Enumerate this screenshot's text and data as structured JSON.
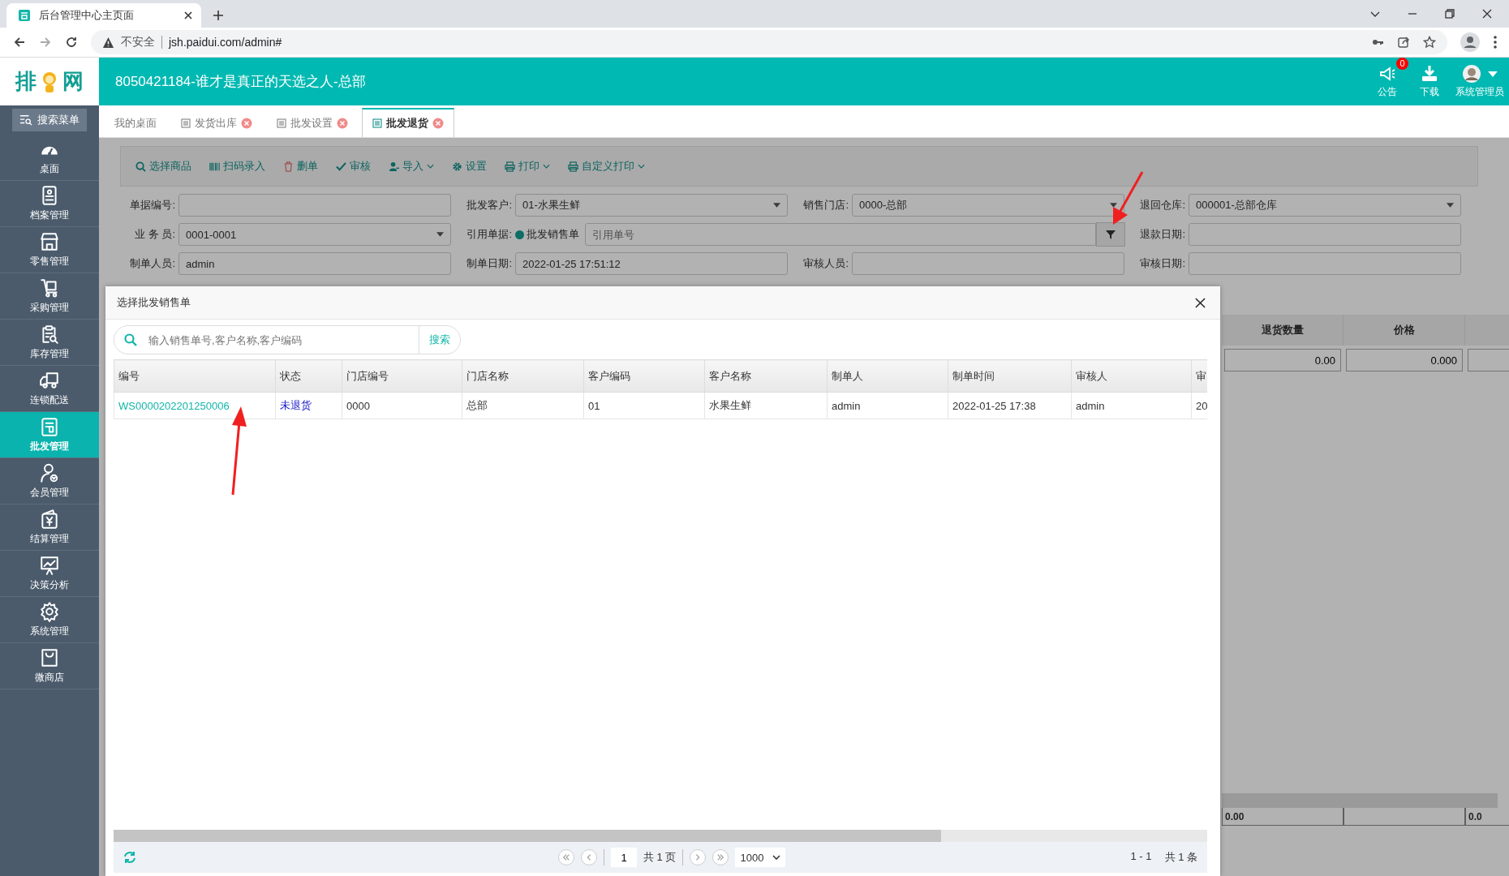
{
  "browser": {
    "tab_title": "后台管理中心主页面",
    "security": "不安全",
    "url": "jsh.paidui.com/admin#"
  },
  "header": {
    "logo": {
      "left": "排",
      "right": "网"
    },
    "title": "8050421184-谁才是真正的天选之人-总部",
    "actions": [
      {
        "kind": "notice",
        "label": "公告",
        "badge": "0"
      },
      {
        "kind": "download",
        "label": "下载"
      },
      {
        "kind": "user",
        "label": "系统管理员"
      }
    ]
  },
  "sidebar": {
    "search_button": "搜索菜单",
    "items": [
      {
        "kind": "dashboard",
        "label": "桌面",
        "selected": false
      },
      {
        "kind": "file",
        "label": "档案管理",
        "selected": false
      },
      {
        "kind": "shop",
        "label": "零售管理",
        "selected": false
      },
      {
        "kind": "cart",
        "label": "采购管理",
        "selected": false
      },
      {
        "kind": "clipboard",
        "label": "库存管理",
        "selected": false
      },
      {
        "kind": "truck",
        "label": "连锁配送",
        "selected": false
      },
      {
        "kind": "wholesale",
        "label": "批发管理",
        "selected": true
      },
      {
        "kind": "member",
        "label": "会员管理",
        "selected": false
      },
      {
        "kind": "wallet",
        "label": "结算管理",
        "selected": false
      },
      {
        "kind": "chart",
        "label": "决策分析",
        "selected": false
      },
      {
        "kind": "gear",
        "label": "系统管理",
        "selected": false
      },
      {
        "kind": "bag",
        "label": "微商店",
        "selected": false
      }
    ]
  },
  "tabs": [
    {
      "label": "我的桌面",
      "closable": false,
      "selected": false
    },
    {
      "label": "发货出库",
      "closable": true,
      "selected": false
    },
    {
      "label": "批发设置",
      "closable": true,
      "selected": false
    },
    {
      "label": "批发退货",
      "closable": true,
      "selected": true
    }
  ],
  "toolbar": [
    {
      "kind": "search",
      "label": "选择商品",
      "dropdown": false
    },
    {
      "kind": "barcode",
      "label": "扫码录入",
      "dropdown": false
    },
    {
      "kind": "trash",
      "label": "删单",
      "dropdown": false
    },
    {
      "kind": "check",
      "label": "审核",
      "dropdown": false
    },
    {
      "kind": "import",
      "label": "导入",
      "dropdown": true
    },
    {
      "kind": "gear",
      "label": "设置",
      "dropdown": false
    },
    {
      "kind": "print",
      "label": "打印",
      "dropdown": true
    },
    {
      "kind": "print",
      "label": "自定义打印",
      "dropdown": true
    }
  ],
  "form": {
    "fields": [
      {
        "kind": "text",
        "label": "单据编号:"
      },
      {
        "kind": "select",
        "label": "批发客户:",
        "value": "01-水果生鲜"
      },
      {
        "kind": "select",
        "label": "销售门店:",
        "value": "0000-总部"
      },
      {
        "kind": "select",
        "label": "退回仓库:",
        "value": "000001-总部仓库"
      },
      {
        "kind": "select",
        "label": "业 务 员:",
        "value": "0001-0001"
      },
      {
        "kind": "reference",
        "label": "引用单据:",
        "option": "批发销售单",
        "option_selected": true,
        "placeholder": "引用单号"
      },
      {
        "kind": "text",
        "label": "退款日期:"
      },
      {
        "kind": "text",
        "label": "制单人员:",
        "value": "admin"
      },
      {
        "kind": "text",
        "label": "制单日期:",
        "value": "2022-01-25 17:51:12"
      },
      {
        "kind": "text",
        "label": "审核人员:"
      },
      {
        "kind": "text",
        "label": "审核日期:"
      }
    ]
  },
  "detail": {
    "columns": [
      {
        "title": "退货数量",
        "value": "0.00",
        "total": "0.00"
      },
      {
        "title": "价格",
        "value": "0.000"
      },
      {
        "total": "0.0"
      }
    ]
  },
  "dialog": {
    "title": "选择批发销售单",
    "search": {
      "placeholder": "输入销售单号,客户名称,客户编码",
      "button": "搜索"
    },
    "table": {
      "columns": [
        {
          "title": "编号",
          "kind": "link"
        },
        {
          "title": "状态",
          "kind": "status"
        },
        {
          "title": "门店编号",
          "kind": "text"
        },
        {
          "title": "门店名称",
          "kind": "text"
        },
        {
          "title": "客户编码",
          "kind": "text"
        },
        {
          "title": "客户名称",
          "kind": "text"
        },
        {
          "title": "制单人",
          "kind": "text"
        },
        {
          "title": "制单时间",
          "kind": "text"
        },
        {
          "title": "审核人",
          "kind": "text"
        },
        {
          "title": "审",
          "kind": "text"
        }
      ],
      "rows": [
        [
          "WS0000202201250006",
          "未退货",
          "0000",
          "总部",
          "01",
          "水果生鲜",
          "admin",
          "2022-01-25 17:38",
          "admin",
          "20"
        ]
      ]
    },
    "pager": {
      "page": "1",
      "pages": "共 1 页",
      "page_size": "1000",
      "range": "1 - 1",
      "total": "共 1 条"
    }
  }
}
